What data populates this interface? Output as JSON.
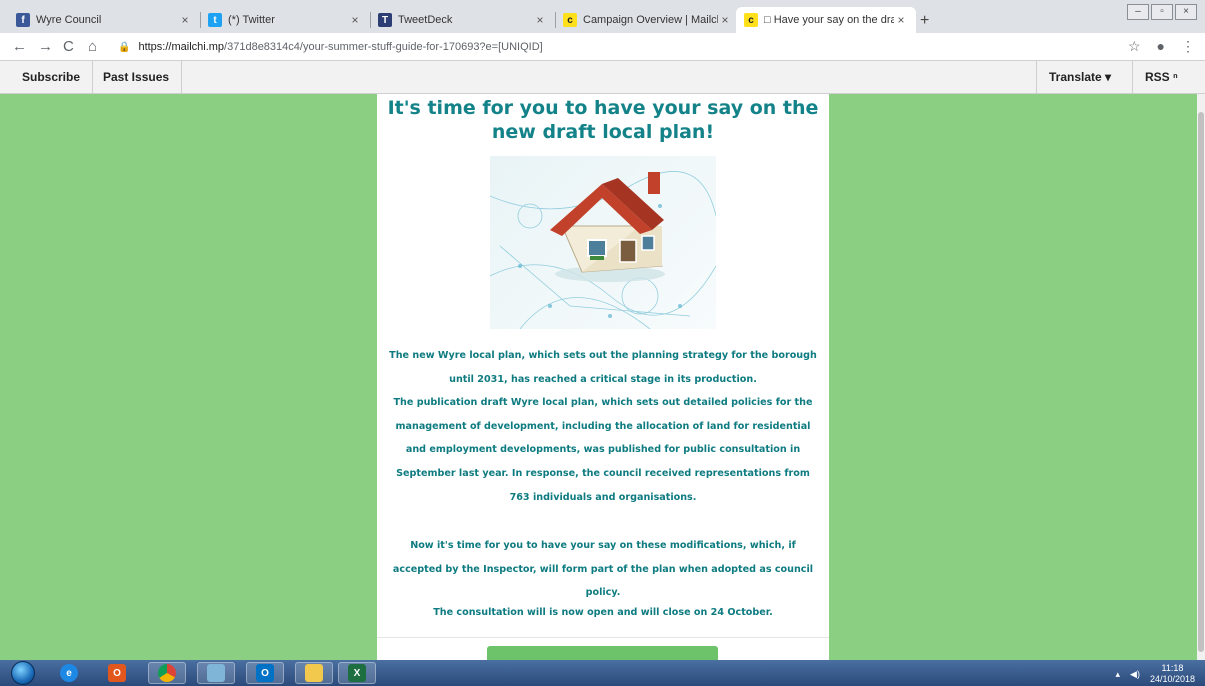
{
  "tabs": [
    {
      "title": "Wyre Council",
      "icon": "facebook-icon",
      "color": "#3b5998"
    },
    {
      "title": "(*) Twitter",
      "icon": "twitter-icon",
      "color": "#1da1f2"
    },
    {
      "title": "TweetDeck",
      "icon": "tweetdeck-icon",
      "color": "#2c3e73"
    },
    {
      "title": "Campaign Overview | Mailchimp",
      "icon": "mailchimp-icon",
      "color": "#ffe01b"
    },
    {
      "title": "□ Have your say on the draft loca",
      "icon": "mailchimp-icon",
      "color": "#ffe01b"
    }
  ],
  "address": {
    "domain": "https://mailchi.mp",
    "path": "/371d8e8314c4/your-summer-stuff-guide-for-170693?e=[UNIQID]"
  },
  "mc_bar": {
    "subscribe": "Subscribe",
    "past_issues": "Past Issues",
    "translate": "Translate ▾",
    "rss": "RSS ⁿ"
  },
  "email": {
    "headline_line1": "It's time for you to have your say on the",
    "headline_line2": "new draft local plan!",
    "p1": "The new Wyre local plan, which sets out the planning strategy for the borough until 2031, has reached a critical stage in its production.",
    "p2": "The publication draft Wyre local plan, which sets out detailed policies for the management of development, including the allocation of land for residential and employment developments, was published for public consultation in September last year.  In response, the council received representations from 763 individuals and organisations.",
    "p3": "Now it's time for you to have your say on these modifications, which, if accepted by the Inspector, will form part of the plan when adopted as council policy.",
    "p4": "The consultation will is now open and will close on 24 October."
  },
  "taskbar": {
    "apps": [
      "internet-explorer-icon",
      "office-icon",
      "chrome-icon",
      "file-icon",
      "outlook-icon",
      "folder-icon",
      "excel-icon"
    ],
    "time": "11:18",
    "date": "24/10/2018"
  },
  "colors": {
    "page_bg": "#8bcf82",
    "heading": "#138389",
    "text": "#0d7b80"
  }
}
